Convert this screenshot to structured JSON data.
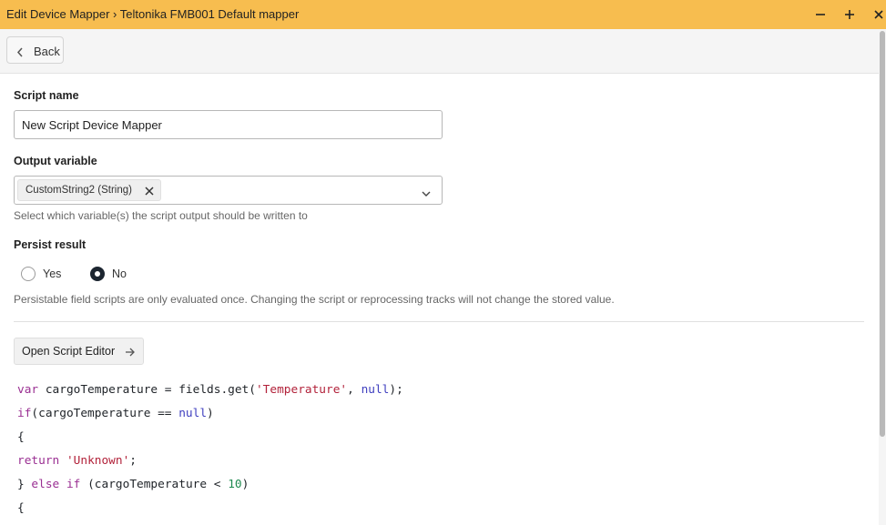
{
  "window": {
    "title": "Edit Device Mapper › Teltonika FMB001 Default mapper",
    "controls": {
      "minimize": "minimize-icon",
      "maximize": "plus-icon",
      "close": "close-icon"
    }
  },
  "toolbar": {
    "back_label": "Back"
  },
  "form": {
    "script_name": {
      "label": "Script name",
      "value": "New Script Device Mapper"
    },
    "output_variable": {
      "label": "Output variable",
      "selected_chip": "CustomString2 (String)",
      "hint": "Select which variable(s) the script output should be written to"
    },
    "persist_result": {
      "label": "Persist result",
      "options": [
        "Yes",
        "No"
      ],
      "selected": "No",
      "hint": "Persistable field scripts are only evaluated once. Changing the script or reprocessing tracks will not change the stored value."
    },
    "open_editor_label": "Open Script Editor"
  },
  "code": {
    "line1": {
      "kw": "var",
      "a": " cargoTemperature = fields.get(",
      "str": "'Temperature'",
      "b": ", ",
      "nul": "null",
      "c": ");"
    },
    "line2": {
      "kw": "if",
      "a": "(cargoTemperature == ",
      "nul": "null",
      "c": ")"
    },
    "line3": "{",
    "line4": {
      "kw": "return",
      "a": " ",
      "str": "'Unknown'",
      "c": ";"
    },
    "line5": {
      "a": "} ",
      "kw1": "else",
      "b": " ",
      "kw2": "if",
      "c": " (cargoTemperature < ",
      "num": "10",
      "d": ")"
    },
    "line6": "{"
  },
  "colors": {
    "titlebar": "#f7bd4f",
    "keyword": "#9a2f92",
    "string": "#b2223a",
    "null": "#3f3fbf",
    "number": "#1f8a50"
  }
}
